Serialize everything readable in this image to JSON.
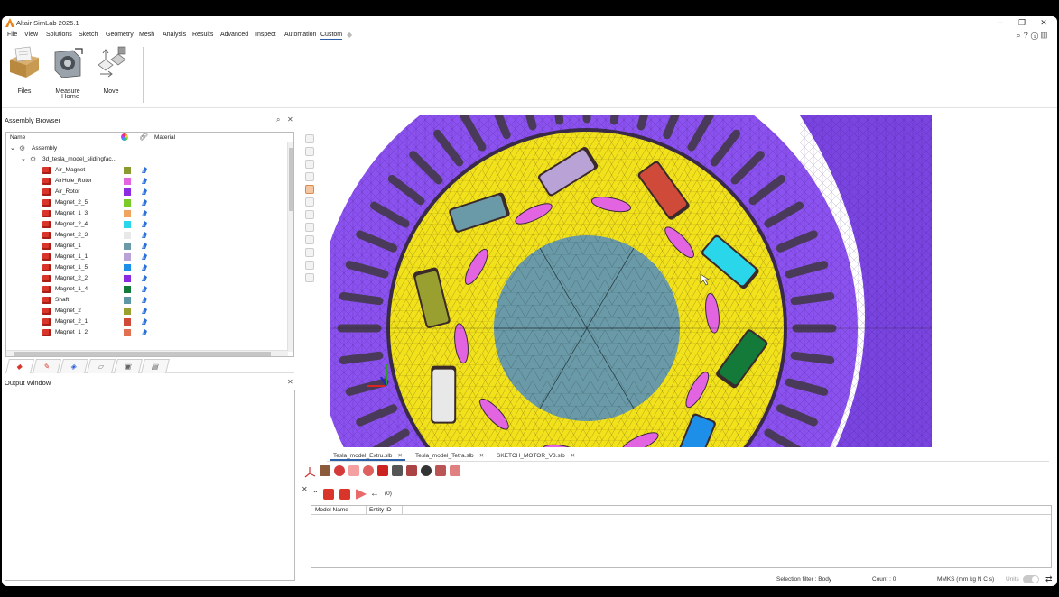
{
  "window": {
    "title": "Altair SimLab 2025.1",
    "minimize": "─",
    "restore": "❐",
    "close": "✕"
  },
  "menu": {
    "items": [
      "File",
      "View",
      "Solutions",
      "Sketch",
      "Geometry",
      "Mesh",
      "Analysis",
      "Results",
      "Advanced",
      "Inspect",
      "Automation",
      "Custom"
    ],
    "active": "Custom",
    "right_icons": [
      "search-icon",
      "help-icon",
      "info-icon",
      "book-icon"
    ]
  },
  "ribbon": {
    "buttons": [
      {
        "label": "Files",
        "icon": "files-icon"
      },
      {
        "label": "Measure",
        "icon": "measure-icon"
      },
      {
        "label": "Move",
        "icon": "move-icon"
      }
    ],
    "group_label": "Home"
  },
  "assembly_browser": {
    "title": "Assembly Browser",
    "columns": {
      "name": "Name",
      "material": "Material"
    },
    "root": "Assembly",
    "model": "3d_tesla_model_slidingfac...",
    "bodies": [
      {
        "name": "Air_Magnet",
        "color": "#8a9a2e"
      },
      {
        "name": "AirHole_Rotor",
        "color": "#e264e0"
      },
      {
        "name": "Air_Rotor",
        "color": "#8d2be2"
      },
      {
        "name": "Magnet_2_5",
        "color": "#7acb2a"
      },
      {
        "name": "Magnet_1_3",
        "color": "#f0a460"
      },
      {
        "name": "Magnet_2_4",
        "color": "#2ad6ea"
      },
      {
        "name": "Magnet_2_3",
        "color": "#e8e8e8"
      },
      {
        "name": "Magnet_1",
        "color": "#6a9aa8"
      },
      {
        "name": "Magnet_1_1",
        "color": "#b8a2d6"
      },
      {
        "name": "Magnet_1_5",
        "color": "#1e8fe8"
      },
      {
        "name": "Magnet_2_2",
        "color": "#8a2be2"
      },
      {
        "name": "Magnet_1_4",
        "color": "#137a3a"
      },
      {
        "name": "Shaft",
        "color": "#5e96a6"
      },
      {
        "name": "Magnet_2",
        "color": "#9aa030"
      },
      {
        "name": "Magnet_2_1",
        "color": "#d04a3a"
      },
      {
        "name": "Magnet_1_2",
        "color": "#e07050"
      }
    ]
  },
  "output_window": {
    "title": "Output Window"
  },
  "doc_tabs": [
    {
      "label": "Tesla_model_Extru.slb",
      "selected": true
    },
    {
      "label": "Tesla_model_Tetra.slb",
      "selected": false
    },
    {
      "label": "SKETCH_MOTOR_V3.slb",
      "selected": false
    }
  ],
  "selection_toolbar": {
    "count_label": "(0)"
  },
  "model_table": {
    "columns": [
      "Model Name",
      "Entity ID"
    ]
  },
  "status": {
    "selection_filter": "Selection filter : Body",
    "count": "Count : 0",
    "units": "MMKS (mm kg N C s)",
    "units_label": "Units"
  },
  "colors": {
    "stator": "#8b52f0",
    "rotor": "#f2e21c",
    "shaft": "#6a9aa8",
    "accent": "#2b5fa8"
  }
}
